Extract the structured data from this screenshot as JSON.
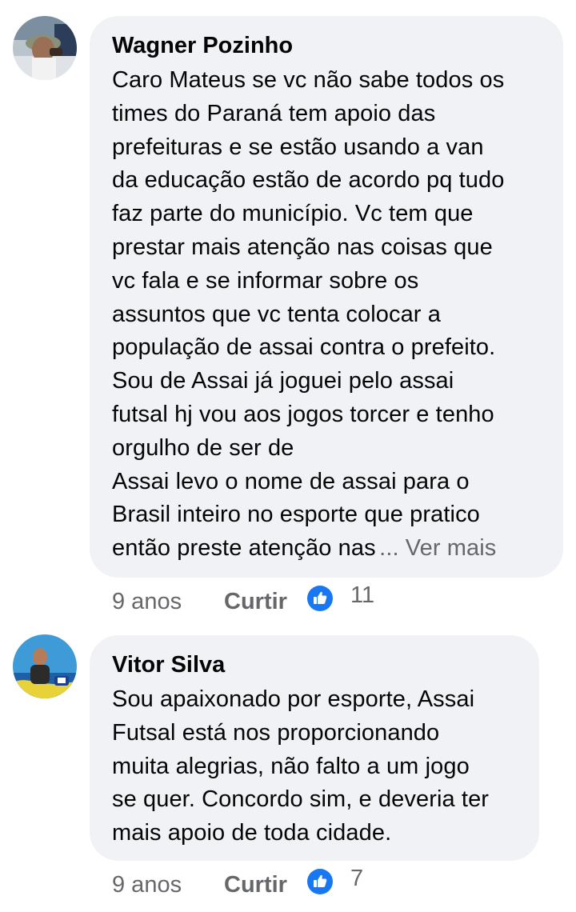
{
  "comments": [
    {
      "author": "Wagner Pozinho",
      "text": "Caro Mateus se vc não sabe todos os\ntimes do Paraná tem apoio das\nprefeituras e se estão usando a van\nda educação estão de acordo pq tudo\nfaz parte do município. Vc tem que\nprestar mais atenção nas coisas que\nvc fala e se informar sobre os\nassuntos que vc tenta colocar a\npopulação de assai contra o prefeito.\nSou de Assai já joguei pelo assai\nfutsal hj vou aos jogos torcer e tenho\norgulho de ser de\nAssai levo o nome de assai para o\nBrasil inteiro no esporte que pratico\nentão preste atenção nas",
      "see_more": "... Ver mais",
      "time": "9 anos",
      "like_label": "Curtir",
      "like_count": "11",
      "avatar_icon": "avatar-photo-icon"
    },
    {
      "author": "Vitor Silva",
      "text": "Sou apaixonado por esporte,  Assai\nFutsal está nos proporcionando\nmuita alegrias,  não falto a um jogo\nse quer. Concordo sim, e deveria ter\nmais apoio de toda cidade.",
      "time": "9 anos",
      "like_label": "Curtir",
      "like_count": "7",
      "avatar_icon": "avatar-photo-icon"
    }
  ],
  "colors": {
    "bubble": "#f0f2f5",
    "secondary_text": "#65676b",
    "like_blue": "#1877f2"
  }
}
